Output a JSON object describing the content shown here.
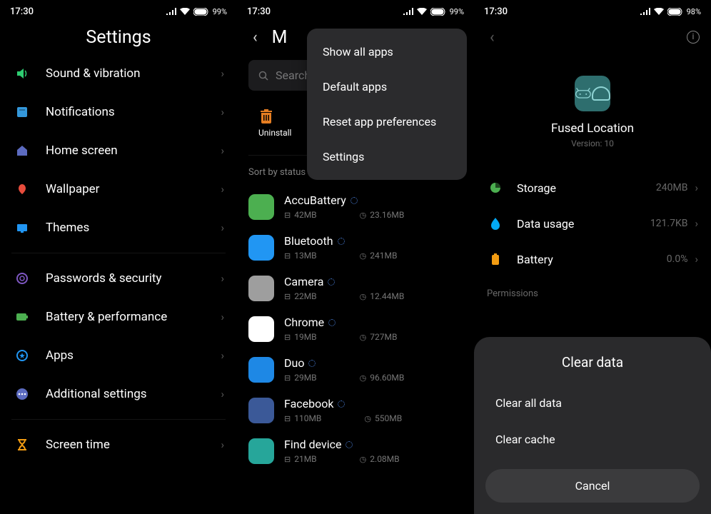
{
  "panel1": {
    "status": {
      "time": "17:30",
      "battery": "99%"
    },
    "title": "Settings",
    "groups": [
      {
        "items": [
          {
            "id": "sound-vibration",
            "label": "Sound & vibration",
            "icon_color": "#2ecc71"
          },
          {
            "id": "notifications",
            "label": "Notifications",
            "icon_color": "#3498db"
          },
          {
            "id": "home-screen",
            "label": "Home screen",
            "icon_color": "#5c6bc0"
          },
          {
            "id": "wallpaper",
            "label": "Wallpaper",
            "icon_color": "#e74c3c"
          },
          {
            "id": "themes",
            "label": "Themes",
            "icon_color": "#2196f3"
          }
        ]
      },
      {
        "items": [
          {
            "id": "passwords-security",
            "label": "Passwords & security",
            "icon_color": "#7e57c2"
          },
          {
            "id": "battery-performance",
            "label": "Battery & performance",
            "icon_color": "#4caf50"
          },
          {
            "id": "apps",
            "label": "Apps",
            "icon_color": "#2196f3"
          },
          {
            "id": "additional-settings",
            "label": "Additional settings",
            "icon_color": "#5c6bc0"
          }
        ]
      },
      {
        "items": [
          {
            "id": "screen-time",
            "label": "Screen time",
            "icon_color": "#f39c12"
          }
        ]
      }
    ]
  },
  "panel2": {
    "status": {
      "time": "17:30",
      "battery": "99%"
    },
    "title": "M",
    "search_placeholder": "Search am",
    "actions": [
      {
        "id": "uninstall",
        "label": "Uninstall"
      }
    ],
    "sort_label": "Sort by status",
    "popup": [
      {
        "id": "show-all",
        "label": "Show all apps"
      },
      {
        "id": "default-apps",
        "label": "Default apps"
      },
      {
        "id": "reset-prefs",
        "label": "Reset app preferences"
      },
      {
        "id": "settings",
        "label": "Settings"
      }
    ],
    "apps": [
      {
        "name": "AccuBattery",
        "size": "42MB",
        "time": "23.16MB",
        "bg": "#4caf50"
      },
      {
        "name": "Bluetooth",
        "size": "13MB",
        "time": "241MB",
        "bg": "#2196f3"
      },
      {
        "name": "Camera",
        "size": "22MB",
        "time": "12.44MB",
        "bg": "#9e9e9e"
      },
      {
        "name": "Chrome",
        "size": "19MB",
        "time": "727MB",
        "bg": "#fff"
      },
      {
        "name": "Duo",
        "size": "29MB",
        "time": "96.60MB",
        "bg": "#1e88e5"
      },
      {
        "name": "Facebook",
        "size": "110MB",
        "time": "550MB",
        "bg": "#3b5998"
      },
      {
        "name": "Find device",
        "size": "21MB",
        "time": "2.08MB",
        "bg": "#26a69a"
      }
    ]
  },
  "panel3": {
    "status": {
      "time": "17:30",
      "battery": "98%"
    },
    "app_name": "Fused Location",
    "version_prefix": "Version: ",
    "version": "10",
    "rows": [
      {
        "id": "storage",
        "label": "Storage",
        "value": "240MB",
        "icon_color": "#4caf50"
      },
      {
        "id": "data-usage",
        "label": "Data usage",
        "value": "121.7KB",
        "icon_color": "#03a9f4"
      },
      {
        "id": "battery",
        "label": "Battery",
        "value": "0.0%",
        "icon_color": "#f39c12"
      }
    ],
    "section_permissions": "Permissions",
    "sheet": {
      "title": "Clear data",
      "options": [
        {
          "id": "clear-all",
          "label": "Clear all data"
        },
        {
          "id": "clear-cache",
          "label": "Clear cache"
        }
      ],
      "cancel": "Cancel"
    }
  }
}
